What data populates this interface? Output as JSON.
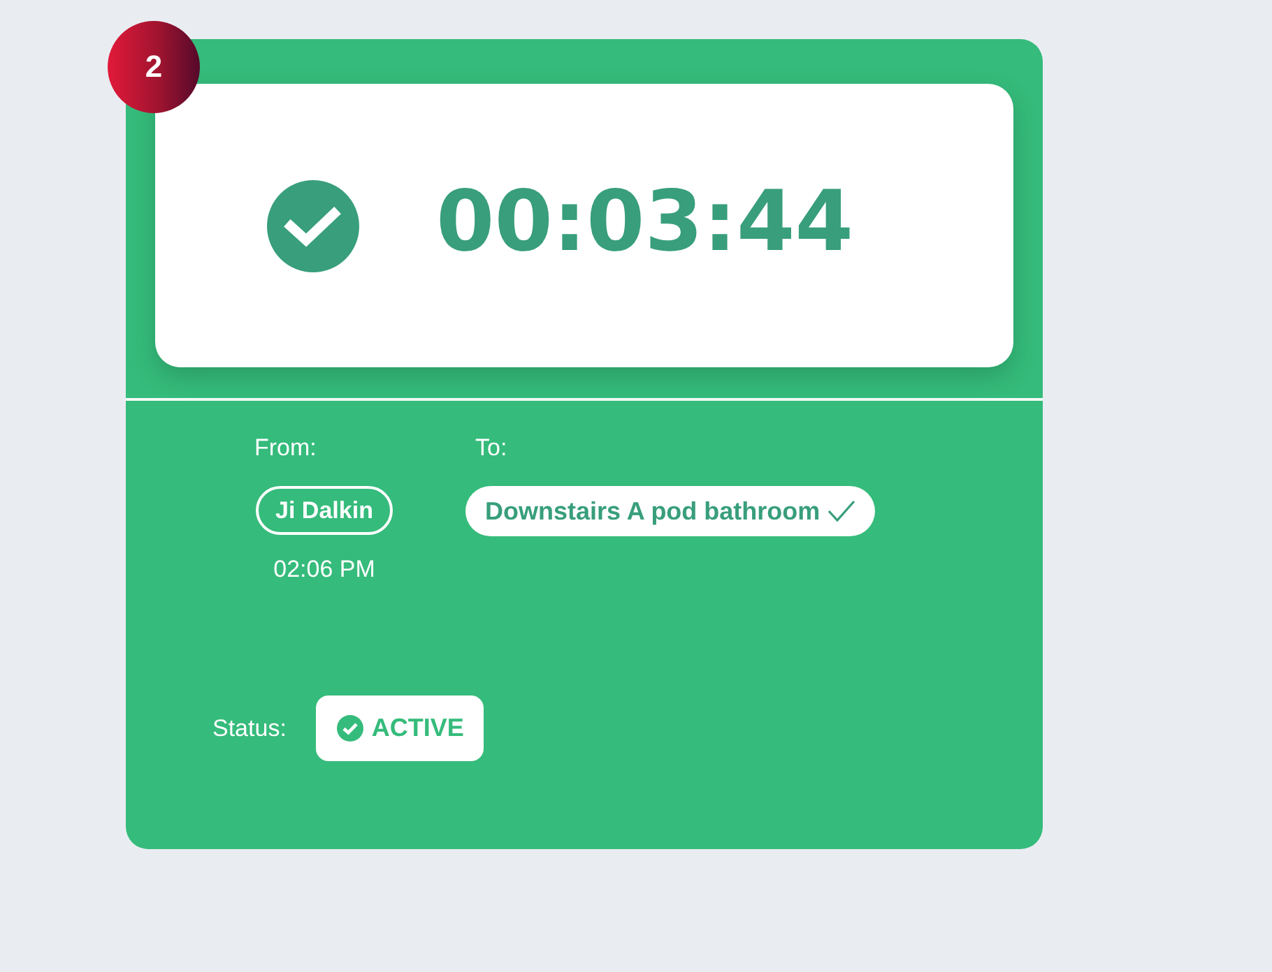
{
  "badge": {
    "number": "2"
  },
  "timer": {
    "elapsed": "00:03:44"
  },
  "route": {
    "from": {
      "label": "From:",
      "name": "Ji Dalkin",
      "time": "02:06 PM"
    },
    "to": {
      "label": "To:",
      "location": "Downstairs A pod bathroom"
    }
  },
  "status": {
    "label": "Status:",
    "value": "ACTIVE"
  }
}
